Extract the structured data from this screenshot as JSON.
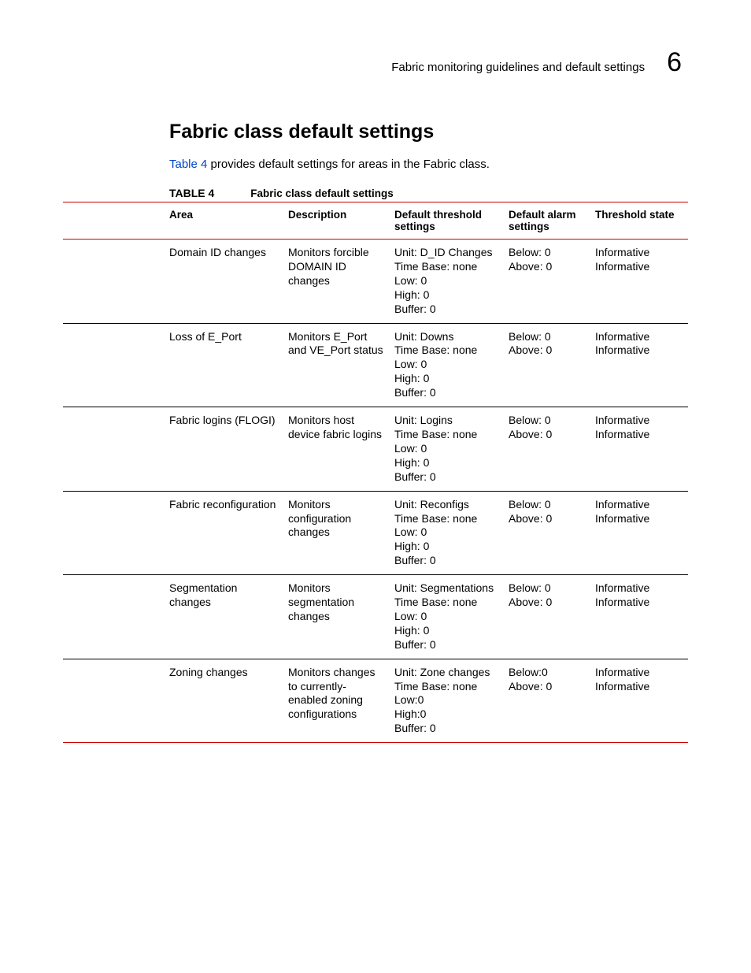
{
  "header": {
    "sectionTitleShort": "Fabric monitoring guidelines and default settings",
    "sectionNumber": "6"
  },
  "title": "Fabric class default settings",
  "introLink": "Table 4",
  "introRest": " provides default settings for areas in the Fabric class.",
  "tableCaptionLabel": "TABLE 4",
  "tableCaptionTitle": "Fabric class default settings",
  "columns": {
    "c0": "Area",
    "c1": "Description",
    "c2": "Default threshold settings",
    "c3": "Default alarm settings",
    "c4": "Threshold state"
  },
  "rows": [
    {
      "area": "Domain ID changes",
      "desc": "Monitors forcible DOMAIN ID changes",
      "thresh": "Unit: D_ID Changes\nTime Base: none\nLow: 0\nHigh: 0\nBuffer: 0",
      "alarm": "Below: 0\nAbove: 0",
      "state": "Informative\nInformative"
    },
    {
      "area": "Loss of E_Port",
      "desc": "Monitors E_Port and VE_Port status",
      "thresh": "Unit: Downs\nTime Base: none\nLow: 0\nHigh: 0\nBuffer: 0",
      "alarm": "Below: 0\nAbove: 0",
      "state": "Informative\nInformative"
    },
    {
      "area": "Fabric logins (FLOGI)",
      "desc": "Monitors host device fabric logins",
      "thresh": "Unit: Logins\nTime Base: none\nLow: 0\nHigh: 0\nBuffer: 0",
      "alarm": "Below: 0\nAbove: 0",
      "state": "Informative\nInformative"
    },
    {
      "area": "Fabric reconfiguration",
      "desc": "Monitors configuration changes",
      "thresh": "Unit: Reconfigs\nTime Base: none\nLow: 0\nHigh: 0\nBuffer: 0",
      "alarm": "Below: 0\nAbove: 0",
      "state": "Informative\nInformative"
    },
    {
      "area": "Segmentation changes",
      "desc": "Monitors segmentation changes",
      "thresh": "Unit: Segmentations\nTime Base: none\nLow: 0\nHigh: 0\nBuffer: 0\n ",
      "alarm": "Below: 0\nAbove: 0",
      "state": "Informative\nInformative"
    },
    {
      "area": "Zoning changes",
      "desc": "Monitors changes to currently-enabled zoning configurations",
      "thresh": "Unit: Zone changes\nTime Base: none\nLow:0\nHigh:0\nBuffer: 0",
      "alarm": "Below:0\nAbove: 0",
      "state": "Informative\nInformative"
    }
  ]
}
